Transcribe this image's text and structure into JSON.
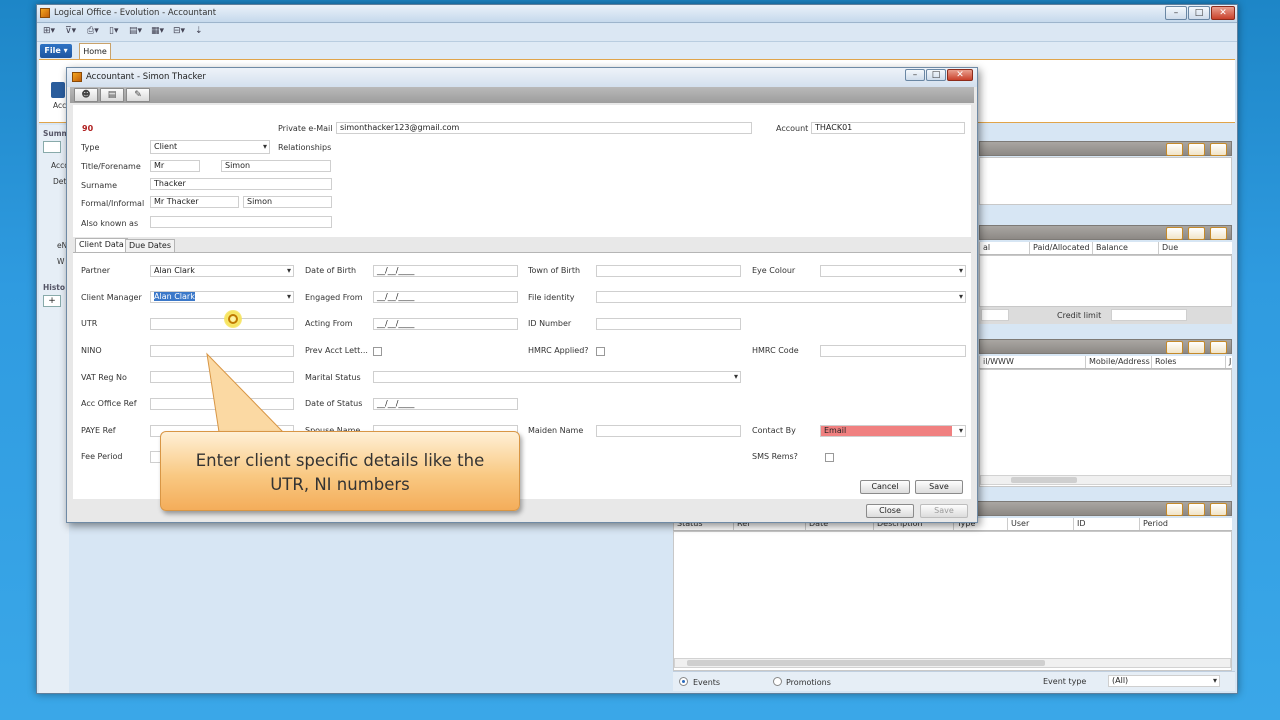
{
  "app": {
    "title": "Logical Office - Evolution - Accountant",
    "file_tab": "File ▾",
    "home_tab": "Home",
    "left_labels": [
      "Summ",
      "Acco",
      "Det",
      "Histo",
      "eN",
      "W"
    ],
    "ribbon_partial_label": "Accou"
  },
  "background_panels": {
    "ledger_columns": [
      "al",
      "Paid/Allocated",
      "Balance",
      "Due"
    ],
    "credit_limit_label": "Credit limit",
    "contacts_columns": [
      "il/WWW",
      "Mobile/Address",
      "Roles",
      "J"
    ],
    "events_columns": [
      "Status",
      "Ref",
      "Date",
      "Description",
      "Type",
      "User",
      "ID",
      "Period"
    ],
    "bottom": {
      "events_label": "Events",
      "promotions_label": "Promotions",
      "event_type_label": "Event type",
      "event_type_value": "(All)"
    },
    "accent_color": "#e0a44a"
  },
  "dialog": {
    "title": "Accountant - Simon Thacker",
    "record_id": "90",
    "type_label": "Type",
    "type_value": "Client",
    "relationships_label": "Relationships",
    "private_email_label": "Private e-Mail",
    "private_email_value": "simonthacker123@gmail.com",
    "account_label": "Account",
    "account_value": "THACK01",
    "title_forename_label": "Title/Forename",
    "title_value": "Mr",
    "forename_value": "Simon",
    "surname_label": "Surname",
    "surname_value": "Thacker",
    "formal_label": "Formal/Informal",
    "formal_value": "Mr Thacker",
    "informal_value": "Simon",
    "aka_label": "Also known as",
    "aka_value": "",
    "tabs": [
      "Client Data",
      "Due Dates"
    ],
    "fields": {
      "partner_label": "Partner",
      "partner_value": "Alan Clark",
      "client_manager_label": "Client Manager",
      "client_manager_value": "Alan Clark",
      "utr_label": "UTR",
      "nino_label": "NINO",
      "vat_label": "VAT Reg No",
      "acc_office_label": "Acc Office Ref",
      "paye_label": "PAYE Ref",
      "fee_period_label": "Fee Period",
      "dob_label": "Date of Birth",
      "engaged_label": "Engaged From",
      "acting_label": "Acting From",
      "prev_acct_label": "Prev Acct Lett...",
      "marital_label": "Marital Status",
      "date_status_label": "Date of Status",
      "spouse_label": "Spouse Name",
      "date_placeholder": "__/__/____",
      "town_label": "Town of Birth",
      "file_identity_label": "File identity",
      "id_number_label": "ID Number",
      "hmrc_applied_label": "HMRC Applied?",
      "maiden_label": "Maiden Name",
      "eye_label": "Eye Colour",
      "hmrc_code_label": "HMRC Code",
      "contact_by_label": "Contact By",
      "contact_by_value": "Email",
      "contact_by_color": "#f08080",
      "sms_label": "SMS Rems?"
    },
    "cancel_label": "Cancel",
    "save_label": "Save",
    "close_label": "Close",
    "save2_label": "Save"
  },
  "callout": {
    "line1": "Enter client specific details like the",
    "line2": "UTR, NI numbers"
  }
}
